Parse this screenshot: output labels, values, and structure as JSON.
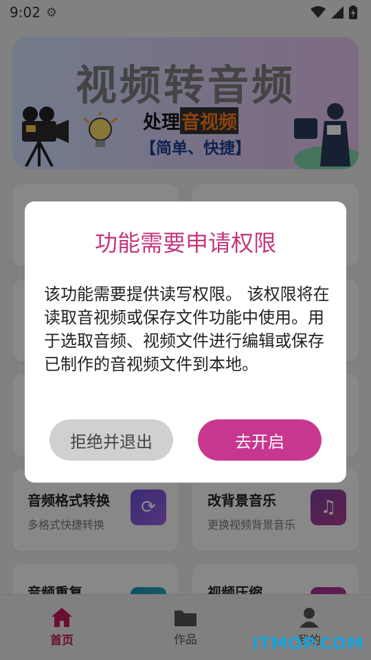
{
  "status": {
    "time": "9:02"
  },
  "banner": {
    "title": "视频转音频",
    "tagline_prefix": "处理",
    "tagline_highlight": "音视频",
    "tagline_suffix": "",
    "bracket_text": "【简单、快捷】"
  },
  "cards": [
    {
      "title": "音频格式转换",
      "desc": "多格式快捷转换",
      "icon": "refresh-icon",
      "color": "#6b4fd8"
    },
    {
      "title": "改背景音乐",
      "desc": "更换视频背景音乐",
      "icon": "music-note-icon",
      "color": "#7b3fa0"
    },
    {
      "title": "音频重复",
      "desc": "",
      "icon": "audio-icon",
      "color": "#2aa7b8"
    },
    {
      "title": "视频压缩",
      "desc": "",
      "icon": "compress-icon",
      "color": "#c0307f"
    }
  ],
  "dialog": {
    "title": "功能需要申请权限",
    "body": "该功能需要提供读写权限。 该权限将在读取音视频或保存文件功能中使用。用于选取音频、视频文件进行编辑或保存已制作的音视频文件到本地。",
    "cancel_label": "拒绝并退出",
    "ok_label": "去开启"
  },
  "nav": {
    "items": [
      {
        "label": "首页",
        "icon": "home-icon",
        "active": true
      },
      {
        "label": "作品",
        "icon": "folder-icon",
        "active": false
      },
      {
        "label": "我的",
        "icon": "user-icon",
        "active": false
      }
    ]
  },
  "watermark": "ITMOP.COM",
  "colors": {
    "accent": "#c8378f",
    "title_pink": "#c2397f"
  }
}
